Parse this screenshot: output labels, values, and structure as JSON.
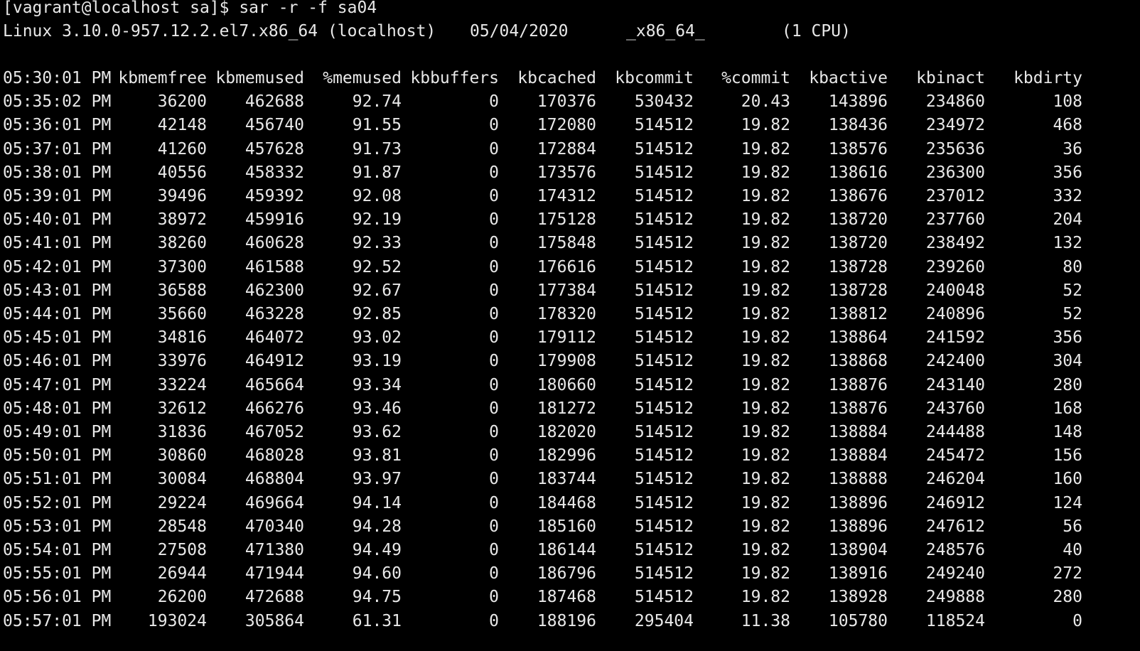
{
  "terminal": {
    "prompt": "[vagrant@localhost sa]$ sar -r -f sa04",
    "system_info": {
      "kernel": "Linux 3.10.0-957.12.2.el7.x86_64 (localhost)",
      "date": "05/04/2020",
      "arch": "_x86_64_",
      "cpus": "(1 CPU)"
    },
    "table": {
      "columns": [
        "05:30:01 PM",
        "kbmemfree",
        "kbmemused",
        "%memused",
        "kbbuffers",
        "kbcached",
        "kbcommit",
        "%commit",
        "kbactive",
        "kbinact",
        "kbdirty"
      ],
      "rows": [
        [
          "05:35:02 PM",
          "36200",
          "462688",
          "92.74",
          "0",
          "170376",
          "530432",
          "20.43",
          "143896",
          "234860",
          "108"
        ],
        [
          "05:36:01 PM",
          "42148",
          "456740",
          "91.55",
          "0",
          "172080",
          "514512",
          "19.82",
          "138436",
          "234972",
          "468"
        ],
        [
          "05:37:01 PM",
          "41260",
          "457628",
          "91.73",
          "0",
          "172884",
          "514512",
          "19.82",
          "138576",
          "235636",
          "36"
        ],
        [
          "05:38:01 PM",
          "40556",
          "458332",
          "91.87",
          "0",
          "173576",
          "514512",
          "19.82",
          "138616",
          "236300",
          "356"
        ],
        [
          "05:39:01 PM",
          "39496",
          "459392",
          "92.08",
          "0",
          "174312",
          "514512",
          "19.82",
          "138676",
          "237012",
          "332"
        ],
        [
          "05:40:01 PM",
          "38972",
          "459916",
          "92.19",
          "0",
          "175128",
          "514512",
          "19.82",
          "138720",
          "237760",
          "204"
        ],
        [
          "05:41:01 PM",
          "38260",
          "460628",
          "92.33",
          "0",
          "175848",
          "514512",
          "19.82",
          "138720",
          "238492",
          "132"
        ],
        [
          "05:42:01 PM",
          "37300",
          "461588",
          "92.52",
          "0",
          "176616",
          "514512",
          "19.82",
          "138728",
          "239260",
          "80"
        ],
        [
          "05:43:01 PM",
          "36588",
          "462300",
          "92.67",
          "0",
          "177384",
          "514512",
          "19.82",
          "138728",
          "240048",
          "52"
        ],
        [
          "05:44:01 PM",
          "35660",
          "463228",
          "92.85",
          "0",
          "178320",
          "514512",
          "19.82",
          "138812",
          "240896",
          "52"
        ],
        [
          "05:45:01 PM",
          "34816",
          "464072",
          "93.02",
          "0",
          "179112",
          "514512",
          "19.82",
          "138864",
          "241592",
          "356"
        ],
        [
          "05:46:01 PM",
          "33976",
          "464912",
          "93.19",
          "0",
          "179908",
          "514512",
          "19.82",
          "138868",
          "242400",
          "304"
        ],
        [
          "05:47:01 PM",
          "33224",
          "465664",
          "93.34",
          "0",
          "180660",
          "514512",
          "19.82",
          "138876",
          "243140",
          "280"
        ],
        [
          "05:48:01 PM",
          "32612",
          "466276",
          "93.46",
          "0",
          "181272",
          "514512",
          "19.82",
          "138876",
          "243760",
          "168"
        ],
        [
          "05:49:01 PM",
          "31836",
          "467052",
          "93.62",
          "0",
          "182020",
          "514512",
          "19.82",
          "138884",
          "244488",
          "148"
        ],
        [
          "05:50:01 PM",
          "30860",
          "468028",
          "93.81",
          "0",
          "182996",
          "514512",
          "19.82",
          "138884",
          "245472",
          "156"
        ],
        [
          "05:51:01 PM",
          "30084",
          "468804",
          "93.97",
          "0",
          "183744",
          "514512",
          "19.82",
          "138888",
          "246204",
          "160"
        ],
        [
          "05:52:01 PM",
          "29224",
          "469664",
          "94.14",
          "0",
          "184468",
          "514512",
          "19.82",
          "138896",
          "246912",
          "124"
        ],
        [
          "05:53:01 PM",
          "28548",
          "470340",
          "94.28",
          "0",
          "185160",
          "514512",
          "19.82",
          "138896",
          "247612",
          "56"
        ],
        [
          "05:54:01 PM",
          "27508",
          "471380",
          "94.49",
          "0",
          "186144",
          "514512",
          "19.82",
          "138904",
          "248576",
          "40"
        ],
        [
          "05:55:01 PM",
          "26944",
          "471944",
          "94.60",
          "0",
          "186796",
          "514512",
          "19.82",
          "138916",
          "249240",
          "272"
        ],
        [
          "05:56:01 PM",
          "26200",
          "472688",
          "94.75",
          "0",
          "187468",
          "514512",
          "19.82",
          "138928",
          "249888",
          "280"
        ],
        [
          "05:57:01 PM",
          "193024",
          "305864",
          "61.31",
          "0",
          "188196",
          "295404",
          "11.38",
          "105780",
          "118524",
          "0"
        ]
      ]
    }
  },
  "colors": {
    "background": "#000000",
    "foreground": "#e8e8e8"
  }
}
